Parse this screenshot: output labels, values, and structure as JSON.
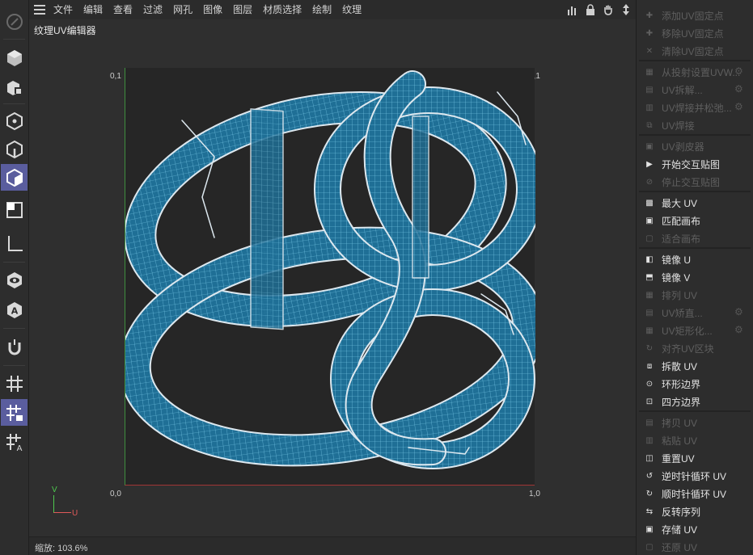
{
  "menubar": {
    "items": [
      "文件",
      "编辑",
      "查看",
      "过滤",
      "网孔",
      "图像",
      "图层",
      "材质选择",
      "绘制",
      "纹理"
    ]
  },
  "viewport": {
    "title": "纹理UV编辑器",
    "corners": {
      "top_left": "0,1",
      "top_right": "1,1",
      "bottom_left": "0,0",
      "bottom_right": "1,0"
    },
    "axis_v": "V",
    "axis_u": "U"
  },
  "status": {
    "zoom": "缩放: 103.6%"
  },
  "left_tools": [
    "brush-icon",
    "cube-mode-icon",
    "object-mode-icon",
    "point-mode-icon",
    "edge-mode-icon",
    "polygon-mode-icon",
    "texture-mode-icon",
    "axis-mode-icon",
    "visibility-icon",
    "texture-tag-icon",
    "magnet-icon",
    "grid-icon",
    "grid-lock-icon",
    "grid-snap-icon"
  ],
  "colors": {
    "accent": "#5a5d9e",
    "mesh": "#2e8fbf",
    "edge": "#dde8ef"
  },
  "right_panel": {
    "items": [
      {
        "label": "添加UV固定点",
        "enabled": false,
        "icon": "pin-add-icon"
      },
      {
        "label": "移除UV固定点",
        "enabled": false,
        "icon": "pin-remove-icon"
      },
      {
        "label": "清除UV固定点",
        "enabled": false,
        "icon": "pin-clear-icon"
      },
      {
        "label": "从投射设置UVW...",
        "enabled": false,
        "icon": "projection-icon",
        "gear": true
      },
      {
        "label": "UV拆解...",
        "enabled": false,
        "icon": "unwrap-icon",
        "gear": true
      },
      {
        "label": "UV焊接并松弛...",
        "enabled": false,
        "icon": "weld-relax-icon",
        "gear": true
      },
      {
        "label": "UV焊接",
        "enabled": false,
        "icon": "weld-icon"
      },
      {
        "label": "UV剥皮器",
        "enabled": false,
        "icon": "peeler-icon"
      },
      {
        "label": "开始交互贴图",
        "enabled": true,
        "icon": "play-icon"
      },
      {
        "label": "停止交互贴图",
        "enabled": false,
        "icon": "stop-icon"
      },
      {
        "label": "最大 UV",
        "enabled": true,
        "icon": "maximize-icon"
      },
      {
        "label": "匹配画布",
        "enabled": true,
        "icon": "match-canvas-icon"
      },
      {
        "label": "适合画布",
        "enabled": false,
        "icon": "fit-canvas-icon"
      },
      {
        "label": "镜像 U",
        "enabled": true,
        "icon": "mirror-u-icon"
      },
      {
        "label": "镜像 V",
        "enabled": true,
        "icon": "mirror-v-icon"
      },
      {
        "label": "排列 UV",
        "enabled": false,
        "icon": "arrange-icon"
      },
      {
        "label": "UV矫直...",
        "enabled": false,
        "icon": "straighten-icon",
        "gear": true
      },
      {
        "label": "UV矩形化...",
        "enabled": false,
        "icon": "rectangularize-icon",
        "gear": true
      },
      {
        "label": "对齐UV区块",
        "enabled": false,
        "icon": "align-islands-icon"
      },
      {
        "label": "拆散 UV",
        "enabled": true,
        "icon": "break-icon"
      },
      {
        "label": "环形边界",
        "enabled": true,
        "icon": "circle-border-icon"
      },
      {
        "label": "四方边界",
        "enabled": true,
        "icon": "square-border-icon"
      },
      {
        "label": "拷贝 UV",
        "enabled": false,
        "icon": "copy-icon"
      },
      {
        "label": "粘贴 UV",
        "enabled": false,
        "icon": "paste-icon"
      },
      {
        "label": "重置UV",
        "enabled": true,
        "icon": "reset-icon"
      },
      {
        "label": "逆时针循环 UV",
        "enabled": true,
        "icon": "rotate-ccw-icon"
      },
      {
        "label": "顺时针循环 UV",
        "enabled": true,
        "icon": "rotate-cw-icon"
      },
      {
        "label": "反转序列",
        "enabled": true,
        "icon": "reverse-icon"
      },
      {
        "label": "存储 UV",
        "enabled": true,
        "icon": "save-icon"
      },
      {
        "label": "还原 UV",
        "enabled": false,
        "icon": "restore-icon"
      }
    ]
  }
}
